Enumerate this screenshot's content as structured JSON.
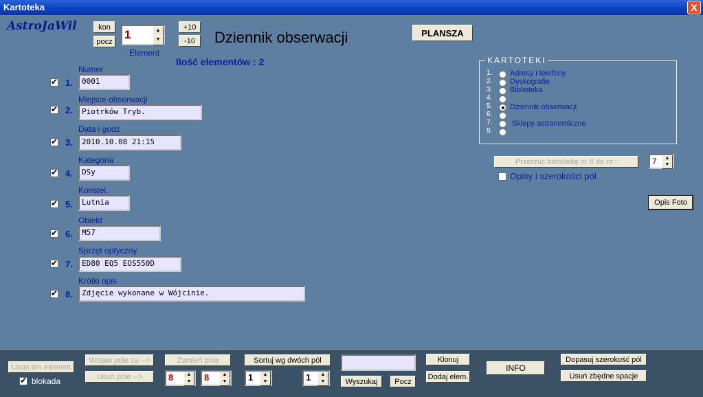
{
  "window": {
    "title": "Kartoteka",
    "close": "X"
  },
  "brand": "AstroJaWil",
  "nav": {
    "kon": "kon",
    "pocz": "pocz",
    "plus10": "+10",
    "minus10": "-10",
    "element_label": "Element",
    "element_value": "1"
  },
  "heading": "Dziennik obserwacji",
  "plansza": "PLANSZA",
  "count_text": "Ilość elementów : 2",
  "fields": [
    {
      "num": "1.",
      "label": "Numer",
      "value": "0001",
      "checked": true
    },
    {
      "num": "2.",
      "label": "Miejsce obserwacji",
      "value": "Piotrków Tryb.",
      "checked": true
    },
    {
      "num": "3.",
      "label": "Data i godz",
      "value": "2010.10.08 21:15",
      "checked": true
    },
    {
      "num": "4.",
      "label": "Kategoria",
      "value": "DSy",
      "checked": true
    },
    {
      "num": "5.",
      "label": "Konstel.",
      "value": "Lutnia",
      "checked": true
    },
    {
      "num": "6.",
      "label": "Obiekt",
      "value": "M57",
      "checked": true
    },
    {
      "num": "7.",
      "label": "Sprzęt optyczny",
      "value": "ED80 EQ5 EOS550D",
      "checked": true
    },
    {
      "num": "8.",
      "label": "Krótki opis",
      "value": "Zdjęcie wykonane w Wójcinie.",
      "checked": true
    }
  ],
  "kartoteki": {
    "title": "KARTOTEKI",
    "items": [
      {
        "num": "1.",
        "label": "Adresy i telefony"
      },
      {
        "num": "2.",
        "label": "Dyskografie"
      },
      {
        "num": "3.",
        "label": "Biblioteka"
      },
      {
        "num": "4.",
        "label": ""
      },
      {
        "num": "5.",
        "label": "Dziennik obserwacji"
      },
      {
        "num": "6.",
        "label": ""
      },
      {
        "num": "7.",
        "label": "Sklepy astronomiczne"
      },
      {
        "num": "8.",
        "label": ""
      }
    ],
    "selected_index": 4
  },
  "przerzuc": {
    "label": "Przerzuć kartotekę nr 8 do nr :",
    "value": "7"
  },
  "opisy_label": "Opisy i szerokości pól",
  "opis_foto": "Opis  Foto",
  "bottom": {
    "usun_element": "Usuń ten element",
    "blokada": "blokada",
    "wstaw_pole": "Wstaw pole za -->",
    "usun_pole": "Usuń pole -->",
    "zamien_pola": "Zamień pola",
    "spin_a": "8",
    "spin_b": "8",
    "sortuj": "Sortuj wg dwóch pól",
    "sort_a": "1",
    "sort_b": "1",
    "search_value": "",
    "wyszukaj": "Wyszukaj",
    "pocz": "Pocz",
    "klonuj": "Klonuj",
    "dodaj": "Dodaj elem.",
    "info": "INFO",
    "dopasuj": "Dopasuj szerokość pól",
    "usun_spacje": "Usuń zbędne spacje"
  }
}
